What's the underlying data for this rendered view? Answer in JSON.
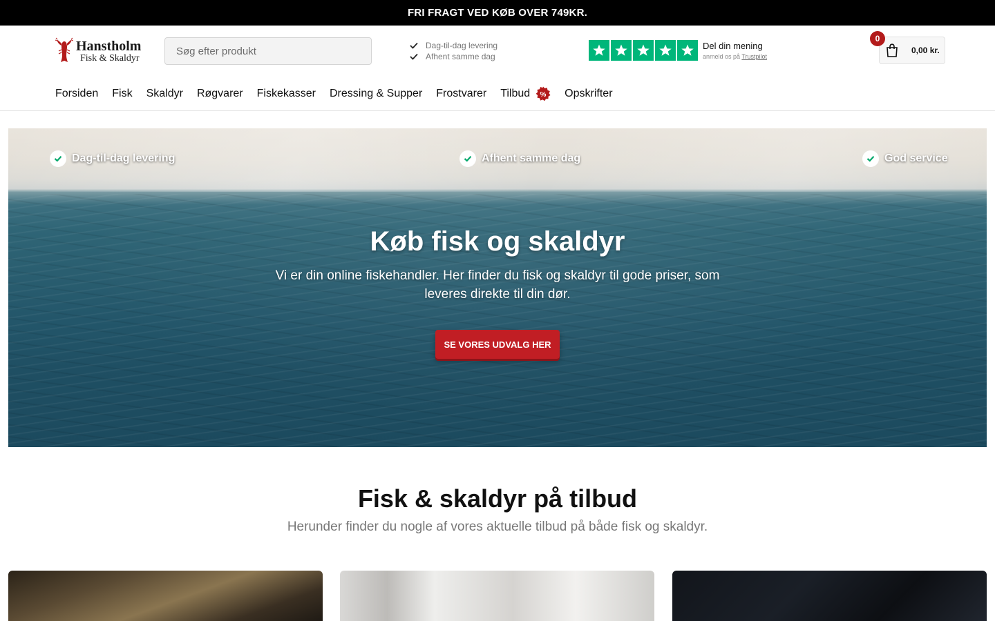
{
  "topbar": {
    "text": "FRI FRAGT VED KØB OVER 749KR."
  },
  "header": {
    "logo": {
      "line1": "Hanstholm",
      "line2": "Fisk & Skaldyr"
    },
    "search_placeholder": "Søg efter produkt",
    "usp": [
      "Dag-til-dag levering",
      "Afhent samme dag"
    ],
    "trustpilot": {
      "stars": 5,
      "title": "Del din mening",
      "sub_prefix": "anmeld os på ",
      "sub_link": "Trustpilot"
    },
    "cart": {
      "count": "0",
      "total": "0,00 kr."
    }
  },
  "nav": {
    "items": [
      "Forsiden",
      "Fisk",
      "Skaldyr",
      "Røgvarer",
      "Fiskekasser",
      "Dressing & Supper",
      "Frostvarer",
      "Tilbud",
      "Opskrifter"
    ],
    "sale_badge": "%"
  },
  "hero": {
    "usps": [
      "Dag-til-dag levering",
      "Afhent samme dag",
      "God service"
    ],
    "title": "Køb fisk og skaldyr",
    "subtitle": "Vi er din online fiskehandler. Her finder du fisk og skaldyr til gode priser, som leveres direkte til din dør.",
    "cta": "SE VORES UDVALG HER"
  },
  "offers": {
    "title": "Fisk & skaldyr på tilbud",
    "subtitle": "Herunder finder du nogle af vores aktuelle tilbud på både fisk og skaldyr."
  },
  "colors": {
    "accent": "#c11e24",
    "trustpilot": "#00b67a",
    "topbar": "#000000"
  }
}
